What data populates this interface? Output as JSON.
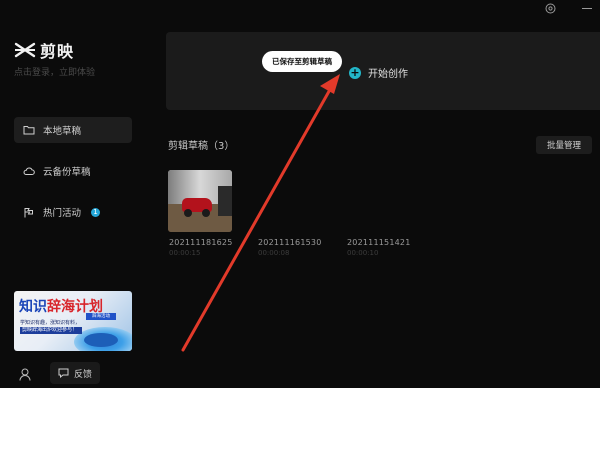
{
  "app": {
    "logo_text": "剪映",
    "login_hint": "点击登录，立即体验"
  },
  "sidebar": {
    "items": [
      {
        "label": "本地草稿",
        "icon": "folder-icon",
        "active": true
      },
      {
        "label": "云备份草稿",
        "icon": "cloud-icon",
        "active": false
      },
      {
        "label": "热门活动",
        "icon": "flag-icon",
        "active": false,
        "badge": "1"
      }
    ],
    "banner": {
      "title_part1": "知识",
      "title_part2": "辞海计划",
      "line1": "学知识有趣，涨知识有料，",
      "line2": "剪映辞海出炉欢迎参与！",
      "tag": "辞海活动"
    },
    "feedback_label": "反馈"
  },
  "create": {
    "button_label": "开始创作",
    "plus_symbol": "+",
    "toast": "已保存至剪辑草稿"
  },
  "drafts": {
    "title": "剪辑草稿（3）",
    "batch_label": "批量管理",
    "items": [
      {
        "name": "202111181625",
        "duration": "00:00:15"
      },
      {
        "name": "202111161530",
        "duration": "00:00:08"
      },
      {
        "name": "202111151421",
        "duration": "00:00:10"
      }
    ]
  },
  "colors": {
    "background": "#0b0b0b",
    "panel": "#1b1b1b",
    "accent": "#23b6c8",
    "annotation_arrow": "#e23a2a"
  }
}
